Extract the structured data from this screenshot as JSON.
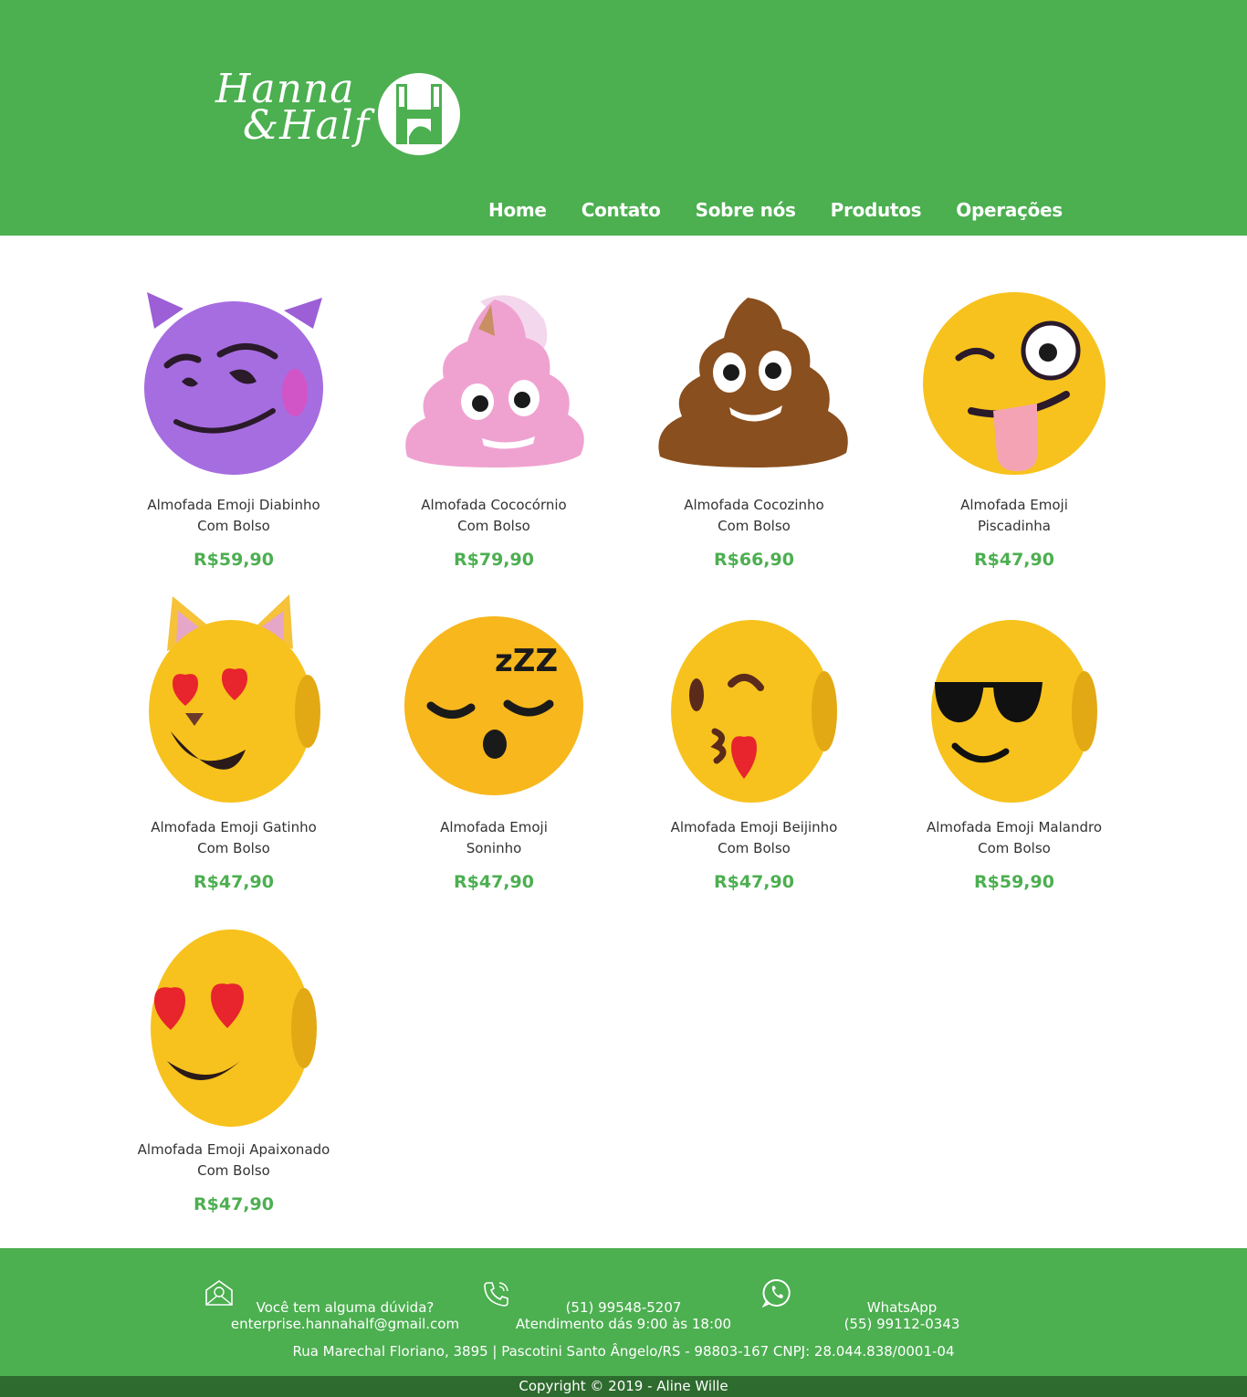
{
  "header": {
    "logo": {
      "line1": "Hanna",
      "line2": "&Half",
      "mark": "H"
    },
    "nav": [
      {
        "label": "Home"
      },
      {
        "label": "Contato"
      },
      {
        "label": "Sobre nós"
      },
      {
        "label": "Produtos"
      },
      {
        "label": "Operações"
      }
    ]
  },
  "products": [
    {
      "line1": "Almofada Emoji Diabinho",
      "line2": "Com Bolso",
      "price": "R$59,90",
      "icon": "devil-emoji-pillow"
    },
    {
      "line1": "Almofada Cococórnio",
      "line2": "Com Bolso",
      "price": "R$79,90",
      "icon": "unicorn-poop-pillow"
    },
    {
      "line1": "Almofada Cocozinho",
      "line2": "Com Bolso",
      "price": "R$66,90",
      "icon": "poop-emoji-pillow"
    },
    {
      "line1": "Almofada Emoji",
      "line2": "Piscadinha",
      "price": "R$47,90",
      "icon": "wink-tongue-emoji-pillow"
    },
    {
      "line1": "Almofada Emoji Gatinho",
      "line2": "Com Bolso",
      "price": "R$47,90",
      "icon": "cat-heart-eyes-emoji-pillow"
    },
    {
      "line1": "Almofada Emoji",
      "line2": "Soninho",
      "price": "R$47,90",
      "icon": "sleeping-emoji-pillow"
    },
    {
      "line1": "Almofada Emoji Beijinho",
      "line2": "Com Bolso",
      "price": "R$47,90",
      "icon": "kiss-emoji-pillow"
    },
    {
      "line1": "Almofada Emoji Malandro",
      "line2": "Com Bolso",
      "price": "R$59,90",
      "icon": "sunglasses-emoji-pillow"
    },
    {
      "line1": "Almofada Emoji Apaixonado",
      "line2": "Com Bolso",
      "price": "R$47,90",
      "icon": "heart-eyes-emoji-pillow"
    }
  ],
  "footer": {
    "email_title": "Você tem alguma dúvida?",
    "email": "enterprise.hannahalf@gmail.com",
    "phone": "(51) 99548-5207",
    "hours": "Atendimento dás 9:00 às 18:00",
    "whatsapp_title": "WhatsApp",
    "whatsapp_number": "(55) 99112-0343",
    "address": "Rua Marechal Floriano, 3895 | Pascotini Santo Ângelo/RS - 98803-167 CNPJ: 28.044.838/0001-04",
    "copyright": "Copyright © 2019 - Aline Wille",
    "icons": [
      "email-icon",
      "phone-icon",
      "whatsapp-icon"
    ]
  },
  "colors": {
    "brand_green": "#4caf50",
    "copyright_bar": "#2e6b2e",
    "price_green": "#4caf50"
  }
}
